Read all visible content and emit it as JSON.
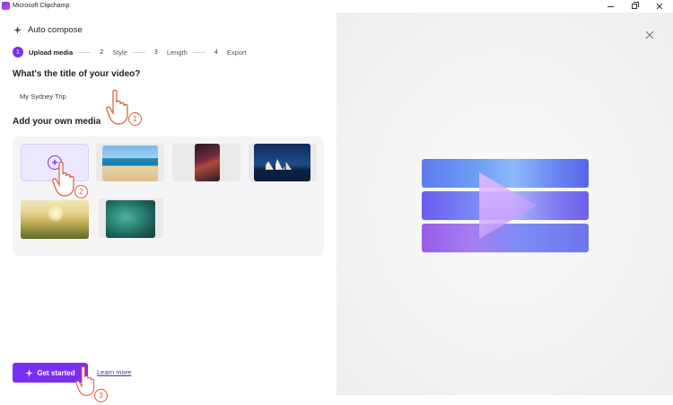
{
  "window": {
    "title": "Microsoft Clipchamp"
  },
  "compose": {
    "title": "Auto compose"
  },
  "steps": [
    {
      "number": "1",
      "label": "Upload media",
      "active": true
    },
    {
      "number": "2",
      "label": "Style",
      "active": false
    },
    {
      "number": "3",
      "label": "Length",
      "active": false
    },
    {
      "number": "4",
      "label": "Export",
      "active": false
    }
  ],
  "title_section": {
    "question": "What's the title of your video?",
    "input_value": "My Sydney Trip"
  },
  "media_section": {
    "heading": "Add your own media",
    "thumbnails": [
      "beach",
      "city-night",
      "opera-house",
      "sunlit-field",
      "reef-aerial"
    ]
  },
  "footer": {
    "primary_button": "Get started",
    "link": "Learn more"
  },
  "annotations": {
    "callout_1": "1",
    "callout_2": "2",
    "callout_3": "3"
  },
  "colors": {
    "accent": "#7a2ef2",
    "callout": "#e0583a"
  },
  "icons": {
    "compose": "sparkle-icon",
    "add_media": "plus-circle-icon",
    "close_preview": "close-icon",
    "button": "sparkle-icon",
    "pointer": "hand-pointer-icon"
  }
}
